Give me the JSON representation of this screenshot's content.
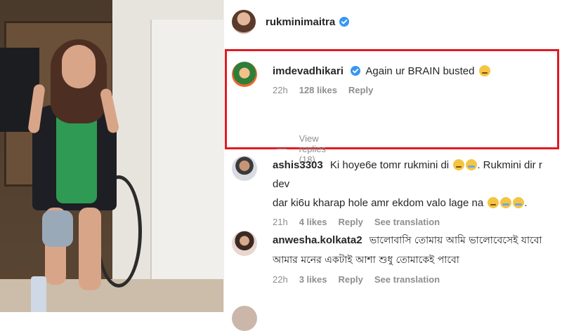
{
  "post": {
    "username": "rukminimaitra",
    "verified": true
  },
  "comments": [
    {
      "username": "imdevadhikari",
      "verified": true,
      "text": "Again ur BRAIN busted",
      "emoji": [
        "sad-face"
      ],
      "time": "22h",
      "likes": "128 likes",
      "reply": "Reply",
      "view_replies": "View replies (18)",
      "highlighted": true
    },
    {
      "username": "ashis3303",
      "text_line1": "Ki hoye6e tomr rukmini di",
      "text_line1_end": ". Rukmini dir r dev",
      "text_line2": "dar ki6u kharap hole amr ekdom valo lage na",
      "time": "21h",
      "likes": "4 likes",
      "reply": "Reply",
      "translate": "See translation"
    },
    {
      "username": "anwesha.kolkata2",
      "text_line1": "ভালোবাসি তোমায় আমি ভালোবেসেই যাবো",
      "text_line2": "আমার মনের একটাই আশা শুধু তোমাকেই পাবো",
      "time": "22h",
      "likes": "3 likes",
      "reply": "Reply",
      "translate": "See translation"
    }
  ],
  "colors": {
    "highlight_border": "#e11a22",
    "verified": "#3897f0",
    "meta_text": "#8e8e8e"
  }
}
